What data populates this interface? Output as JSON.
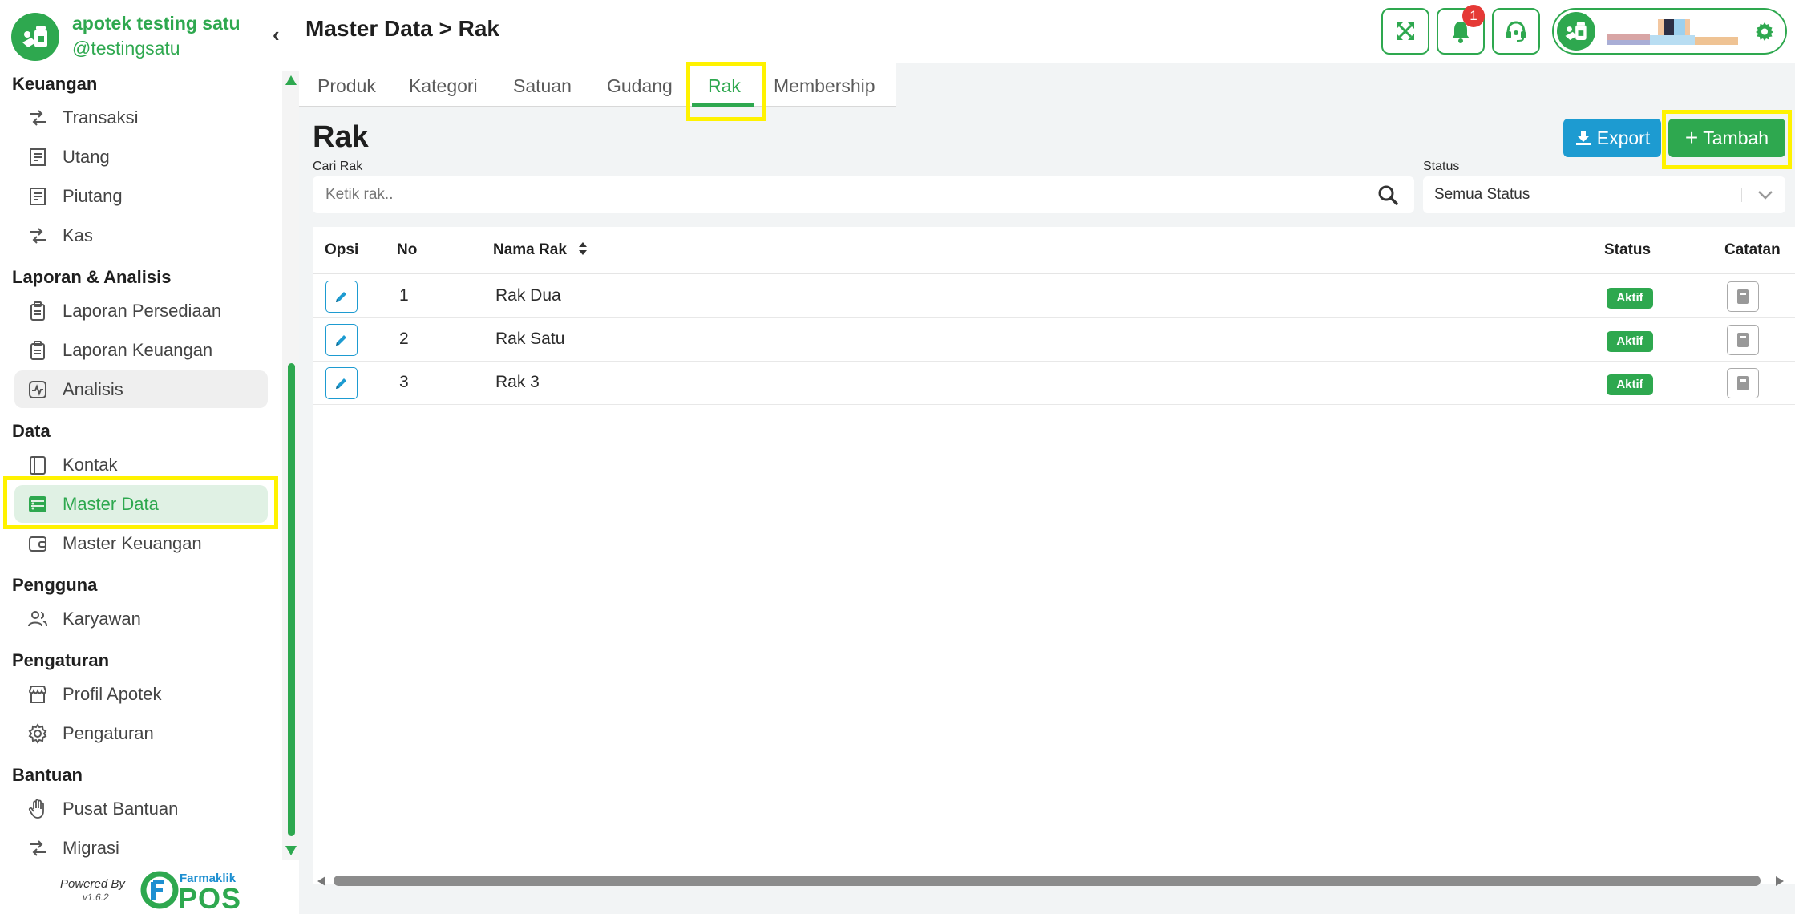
{
  "brand": {
    "name": "apotek testing satu",
    "handle": "@testingsatu"
  },
  "header": {
    "title": "Master Data > Rak",
    "notification_count": "1"
  },
  "sidebar": {
    "sections": [
      {
        "title": "Keuangan",
        "items": [
          "Transaksi",
          "Utang",
          "Piutang",
          "Kas"
        ]
      },
      {
        "title": "Laporan & Analisis",
        "items": [
          "Laporan Persediaan",
          "Laporan Keuangan",
          "Analisis"
        ]
      },
      {
        "title": "Data",
        "items": [
          "Kontak",
          "Master Data",
          "Master Keuangan"
        ]
      },
      {
        "title": "Pengguna",
        "items": [
          "Karyawan"
        ]
      },
      {
        "title": "Pengaturan",
        "items": [
          "Profil Apotek",
          "Pengaturan"
        ]
      },
      {
        "title": "Bantuan",
        "items": [
          "Pusat Bantuan",
          "Migrasi"
        ]
      }
    ],
    "active_item": "Master Data",
    "hover_item": "Analisis"
  },
  "footer": {
    "powered_by": "Powered By",
    "version": "v1.6.2",
    "brand_top": "Farmaklik",
    "brand_big": "POS"
  },
  "tabs": [
    "Produk",
    "Kategori",
    "Satuan",
    "Gudang",
    "Rak",
    "Membership"
  ],
  "active_tab": "Rak",
  "content": {
    "title": "Rak",
    "export_label": "Export",
    "add_label": "Tambah",
    "search_label": "Cari Rak",
    "search_placeholder": "Ketik rak..",
    "status_label": "Status",
    "status_value": "Semua Status"
  },
  "table": {
    "headers": {
      "opsi": "Opsi",
      "no": "No",
      "nama": "Nama Rak",
      "status": "Status",
      "catatan": "Catatan"
    },
    "rows": [
      {
        "no": "1",
        "nama": "Rak Dua",
        "status": "Aktif"
      },
      {
        "no": "2",
        "nama": "Rak Satu",
        "status": "Aktif"
      },
      {
        "no": "3",
        "nama": "Rak 3",
        "status": "Aktif"
      }
    ]
  },
  "colors": {
    "primary": "#2ea84f",
    "info": "#1d9bd1",
    "highlight": "#fff200",
    "danger": "#e53935"
  },
  "icons": {
    "header_buttons": [
      "fullscreen-icon",
      "bell-icon",
      "headset-icon"
    ],
    "sidebar": [
      "transfer-icon",
      "receipt-icon",
      "receipt-icon",
      "transfer-icon",
      "clipboard-icon",
      "clipboard-icon",
      "pulse-icon",
      "book-icon",
      "database-icon",
      "wallet-icon",
      "users-icon",
      "store-icon",
      "gear-icon",
      "hand-icon",
      "transfer-icon"
    ]
  }
}
